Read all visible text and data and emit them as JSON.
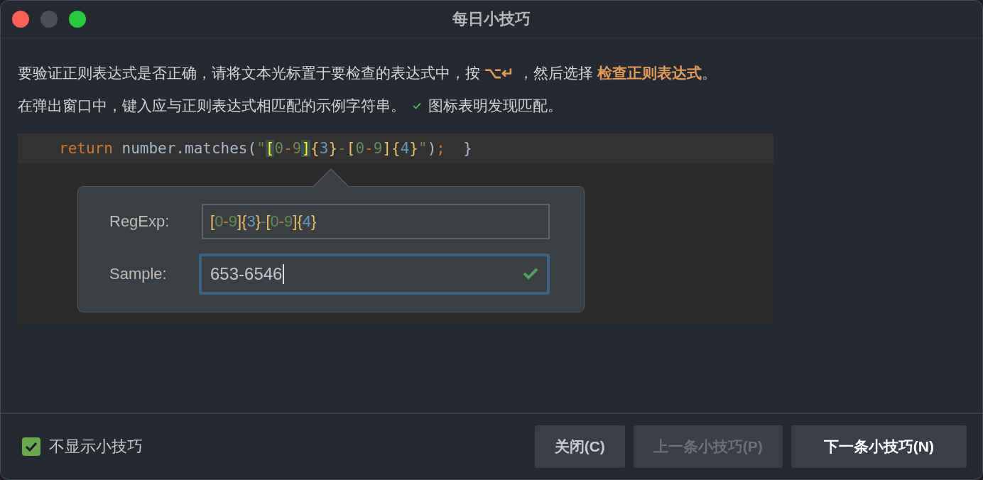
{
  "window": {
    "title": "每日小技巧"
  },
  "paragraphs": [
    {
      "text": "要验证正则表达式是否正确，请将文本光标置于要检查的表达式中，按 **⌥↵** ，然后选择 **检查正则表达式**。"
    }
  ],
  "match_note": {
    "before": "在弹出窗口中，键入应与正则表达式相匹配的示例字符串。",
    "after": "图标表明发现匹配。"
  },
  "code_line": [
    {
      "text": "return",
      "kind": "keyword",
      "highlighted": false
    },
    {
      "text": " number.matches(",
      "kind": "plain",
      "highlighted": false
    },
    {
      "text": "\"",
      "kind": "string",
      "highlighted": false
    },
    {
      "text": "[",
      "kind": "bracket",
      "highlighted": true
    },
    {
      "text": "0",
      "kind": "range",
      "highlighted": false
    },
    {
      "text": "-",
      "kind": "dash",
      "highlighted": false
    },
    {
      "text": "9",
      "kind": "range",
      "highlighted": false
    },
    {
      "text": "]",
      "kind": "bracket",
      "highlighted": true
    },
    {
      "text": "{",
      "kind": "brace",
      "highlighted": false
    },
    {
      "text": "3",
      "kind": "count",
      "highlighted": false
    },
    {
      "text": "}",
      "kind": "brace",
      "highlighted": false
    },
    {
      "text": "-",
      "kind": "literal",
      "highlighted": false
    },
    {
      "text": "[",
      "kind": "bracket",
      "highlighted": false
    },
    {
      "text": "0",
      "kind": "range",
      "highlighted": false
    },
    {
      "text": "-",
      "kind": "dash",
      "highlighted": false
    },
    {
      "text": "9",
      "kind": "range",
      "highlighted": false
    },
    {
      "text": "]",
      "kind": "bracket",
      "highlighted": false
    },
    {
      "text": "{",
      "kind": "brace",
      "highlighted": false
    },
    {
      "text": "4",
      "kind": "count",
      "highlighted": false
    },
    {
      "text": "}",
      "kind": "brace",
      "highlighted": false
    },
    {
      "text": "\"",
      "kind": "string",
      "highlighted": false
    },
    {
      "text": ")",
      "kind": "plain",
      "highlighted": false
    },
    {
      "text": ";",
      "kind": "keyword",
      "highlighted": false
    },
    {
      "text": "  }",
      "kind": "plain",
      "highlighted": false
    }
  ],
  "popup": {
    "regexp_label": "RegExp:",
    "regexp_tokens": [
      {
        "text": "[",
        "kind": "bracket"
      },
      {
        "text": "0",
        "kind": "range"
      },
      {
        "text": "-",
        "kind": "dash"
      },
      {
        "text": "9",
        "kind": "range"
      },
      {
        "text": "]",
        "kind": "bracket"
      },
      {
        "text": "{",
        "kind": "brace"
      },
      {
        "text": "3",
        "kind": "count"
      },
      {
        "text": "}",
        "kind": "brace"
      },
      {
        "text": "-",
        "kind": "literal"
      },
      {
        "text": "[",
        "kind": "bracket"
      },
      {
        "text": "0",
        "kind": "range"
      },
      {
        "text": "-",
        "kind": "dash"
      },
      {
        "text": "9",
        "kind": "range"
      },
      {
        "text": "]",
        "kind": "bracket"
      },
      {
        "text": "{",
        "kind": "brace"
      },
      {
        "text": "4",
        "kind": "count"
      },
      {
        "text": "}",
        "kind": "brace"
      }
    ],
    "sample_label": "Sample:",
    "sample_value": "653-6546",
    "matched": true
  },
  "footer": {
    "dont_show": {
      "label": "不显示小技巧",
      "checked": true
    },
    "buttons": [
      {
        "label": "关闭(C)",
        "disabled": false,
        "default": false
      },
      {
        "label": "上一条小技巧(P)",
        "disabled": true,
        "default": false
      },
      {
        "label": "下一条小技巧(N)",
        "disabled": false,
        "default": true
      }
    ]
  }
}
